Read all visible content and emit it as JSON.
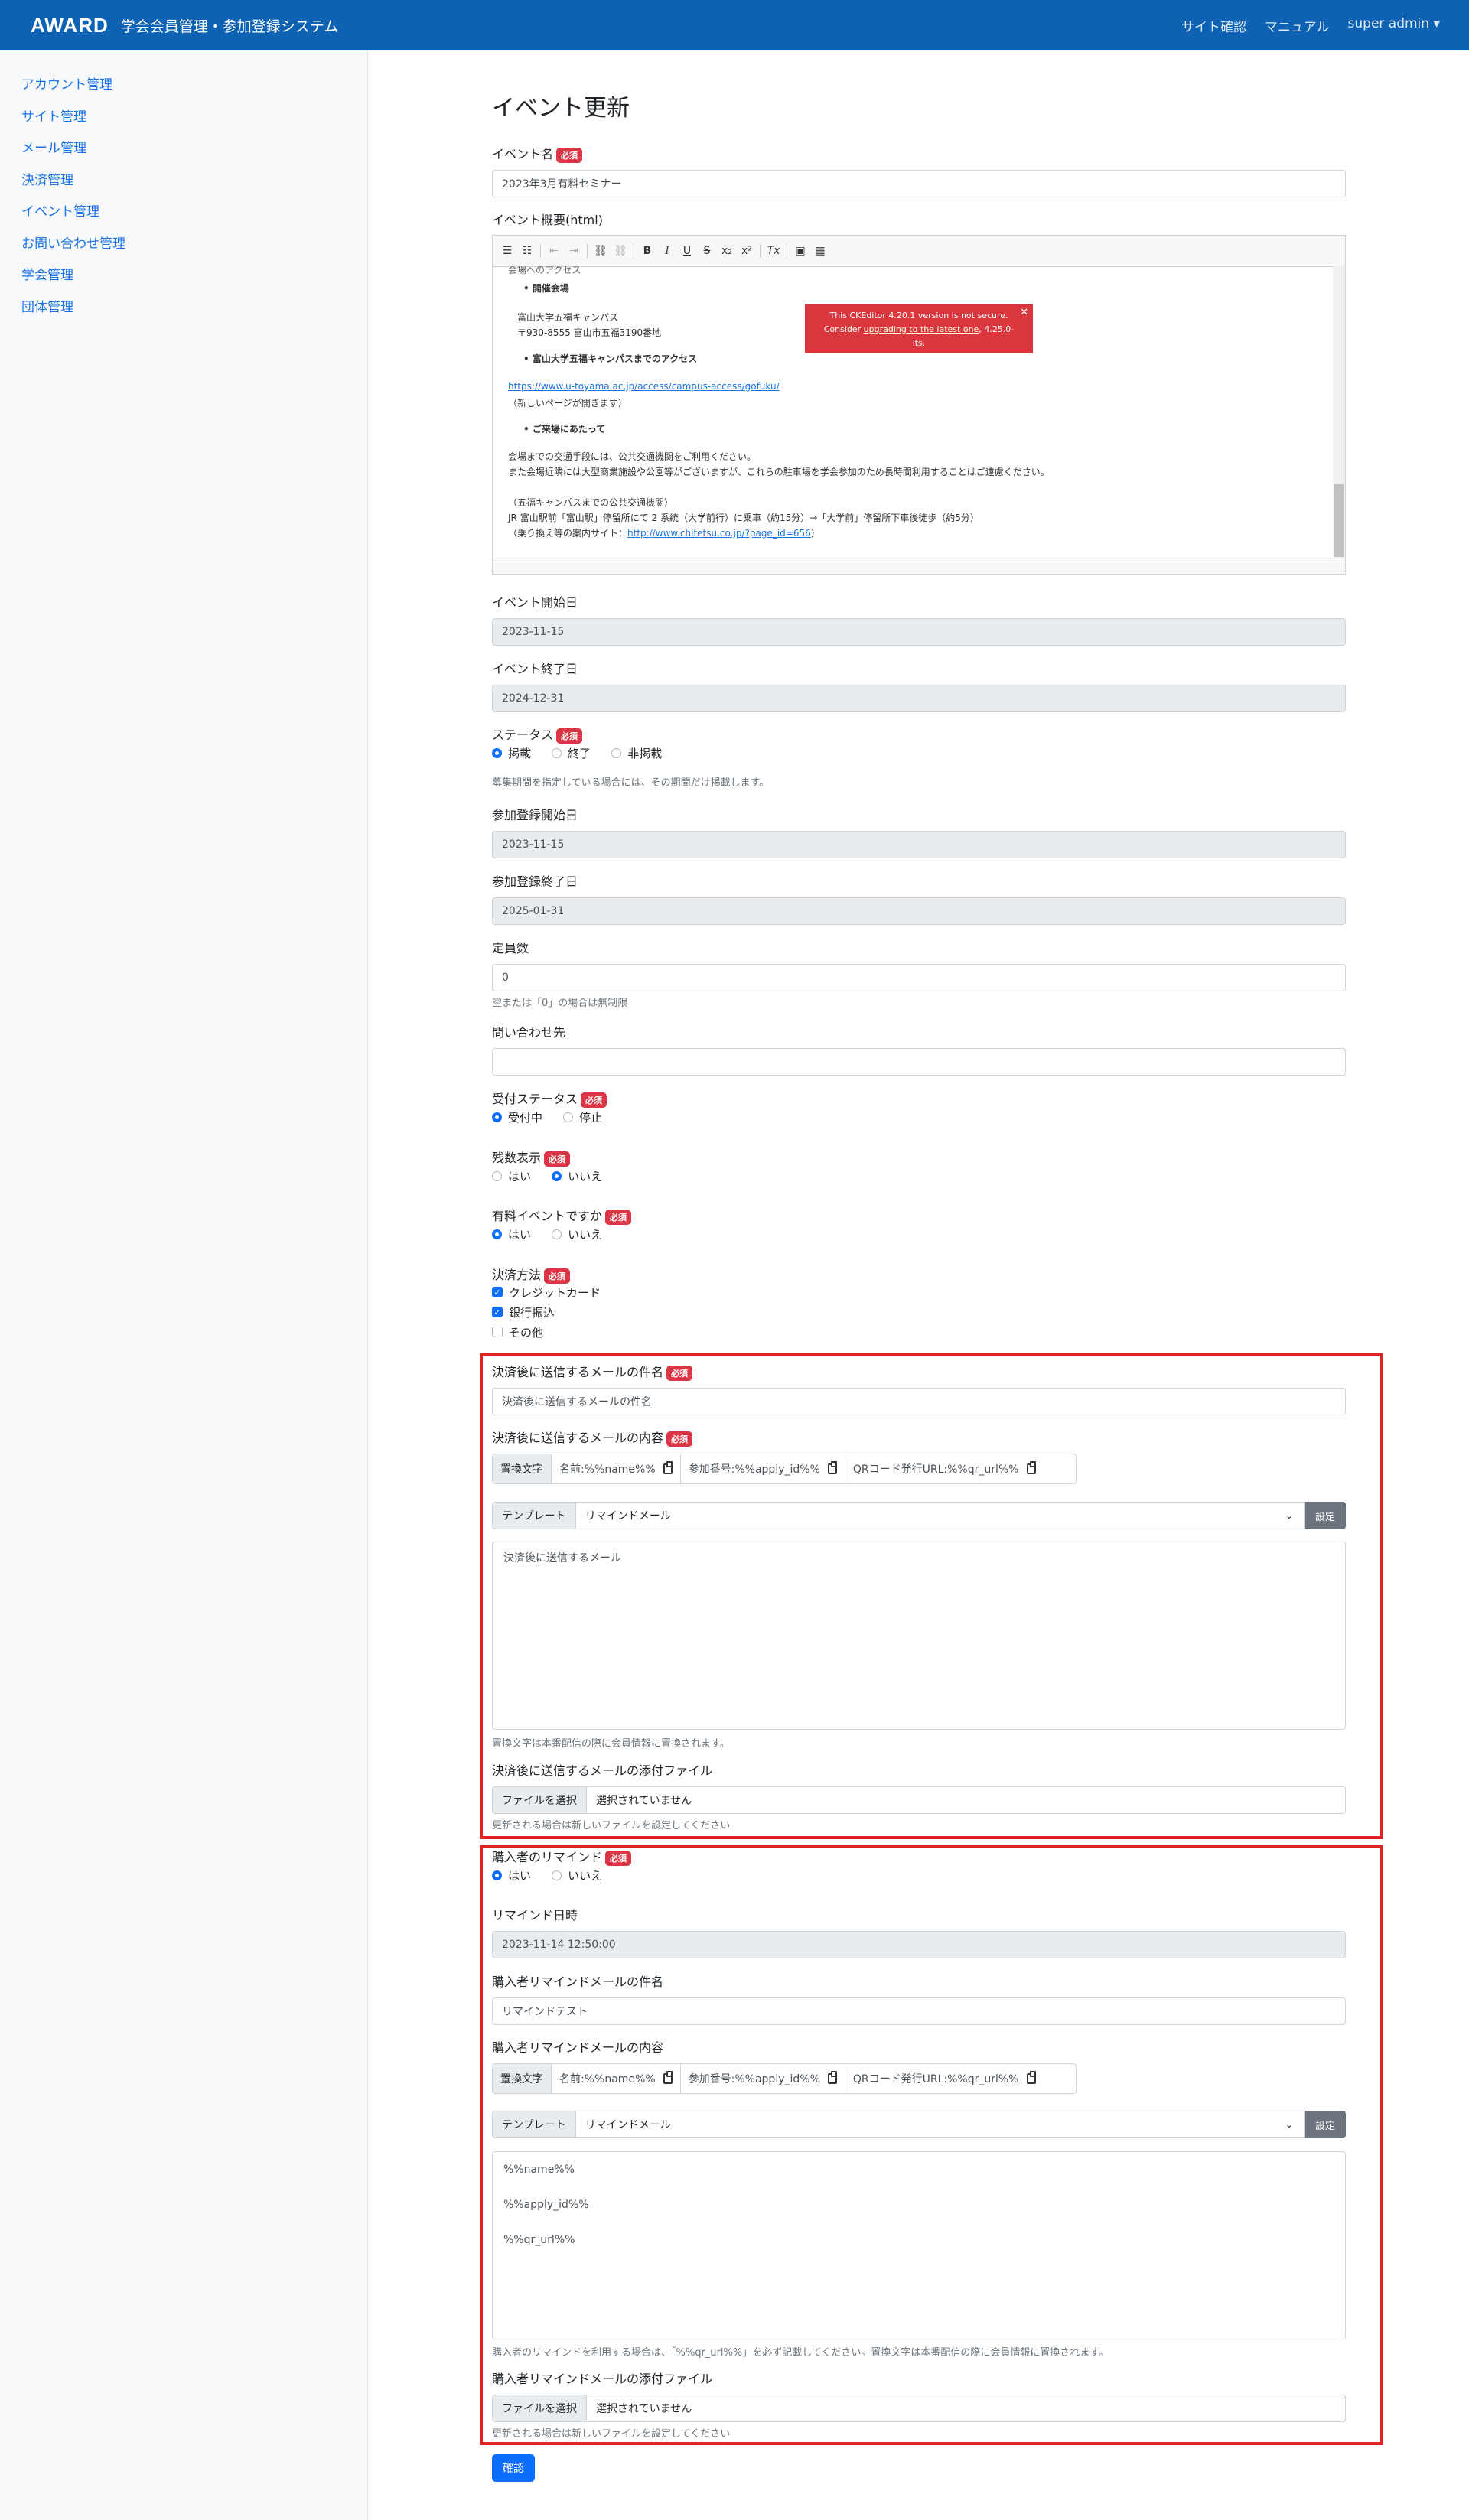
{
  "header": {
    "logo": "AWARD",
    "title": "学会会員管理・参加登録システム",
    "links": [
      "サイト確認",
      "マニュアル",
      "super admin ▾"
    ]
  },
  "sidebar": {
    "items": [
      "アカウント管理",
      "サイト管理",
      "メール管理",
      "決済管理",
      "イベント管理",
      "お問い合わせ管理",
      "学会管理",
      "団体管理"
    ]
  },
  "page": {
    "title": "イベント更新",
    "required": "必須",
    "event_name": {
      "label": "イベント名",
      "value": "2023年3月有料セミナー"
    },
    "overview": {
      "label": "イベント概要(html)"
    },
    "editor": {
      "lines": [
        "会場へのアクセス",
        "開催会場",
        "富山大学五福キャンパス",
        "〒930-8555 富山市五福3190番地",
        "富山大学五福キャンパスまでのアクセス",
        "https://www.u-toyama.ac.jp/access/campus-access/gofuku/",
        "（新しいページが開きます）",
        "ご来場にあたって",
        "会場までの交通手段には、公共交通機関をご利用ください。",
        "また会場近隣には大型商業施設や公園等がございますが、これらの駐車場を学会参加のため長時間利用することはご遠慮ください。",
        "（五福キャンパスまでの公共交通機関）",
        "JR 富山駅前「富山駅」停留所にて 2 系統（大学前行）に乗車（約15分）→「大学前」停留所下車後徒歩（約5分）",
        "（乗り換え等の案内サイト：",
        "http://www.chitetsu.co.jp/?page_id=656",
        "）"
      ],
      "warning": {
        "line1": "This CKEditor 4.20.1 version is not secure.",
        "line2a": "Consider ",
        "link": "upgrading to the latest one",
        "line2b": ", 4.25.0-",
        "line3": "lts.",
        "close": "✕"
      }
    },
    "start_date": {
      "label": "イベント開始日",
      "value": "2023-11-15"
    },
    "end_date": {
      "label": "イベント終了日",
      "value": "2024-12-31"
    },
    "status": {
      "label": "ステータス",
      "options": [
        "掲載",
        "終了",
        "非掲載"
      ],
      "hint": "募集期間を指定している場合には、その期間だけ掲載します。"
    },
    "reg_start": {
      "label": "参加登録開始日",
      "value": "2023-11-15"
    },
    "reg_end": {
      "label": "参加登録終了日",
      "value": "2025-01-31"
    },
    "capacity": {
      "label": "定員数",
      "value": "0",
      "hint": "空または「0」の場合は無制限"
    },
    "contact": {
      "label": "問い合わせ先",
      "value": ""
    },
    "accept_status": {
      "label": "受付ステータス",
      "options": [
        "受付中",
        "停止"
      ]
    },
    "remaining": {
      "label": "残数表示",
      "options": [
        "はい",
        "いいえ"
      ]
    },
    "paid": {
      "label": "有料イベントですか",
      "options": [
        "はい",
        "いいえ"
      ]
    },
    "payment": {
      "label": "決済方法",
      "options": [
        "クレジットカード",
        "銀行振込",
        "その他"
      ]
    },
    "post_mail": {
      "subject_label": "決済後に送信するメールの件名",
      "subject_value": "決済後に送信するメールの件名",
      "body_label": "決済後に送信するメールの内容",
      "replace_label": "置換文字",
      "vars": [
        "名前:%%name%%",
        "参加番号:%%apply_id%%",
        "QRコード発行URL:%%qr_url%%"
      ],
      "template_label": "テンプレート",
      "template_value": "リマインドメール",
      "set_button": "設定",
      "body_value": "決済後に送信するメール",
      "body_hint": "置換文字は本番配信の際に会員情報に置換されます。",
      "attach_label": "決済後に送信するメールの添付ファイル",
      "file_button": "ファイルを選択",
      "file_none": "選択されていません",
      "attach_hint": "更新される場合は新しいファイルを設定してください"
    },
    "remind": {
      "label": "購入者のリマインド",
      "options": [
        "はい",
        "いいえ"
      ],
      "datetime_label": "リマインド日時",
      "datetime_value": "2023-11-14 12:50:00",
      "subject_label": "購入者リマインドメールの件名",
      "subject_value": "リマインドテスト",
      "body_label": "購入者リマインドメールの内容",
      "replace_label": "置換文字",
      "vars": [
        "名前:%%name%%",
        "参加番号:%%apply_id%%",
        "QRコード発行URL:%%qr_url%%"
      ],
      "template_label": "テンプレート",
      "template_value": "リマインドメール",
      "set_button": "設定",
      "body_lines": [
        "%%name%%",
        "%%apply_id%%",
        "%%qr_url%%"
      ],
      "body_hint": "購入者のリマインドを利用する場合は、「%%qr_url%%」を必ず記載してください。置換文字は本番配信の際に会員情報に置換されます。",
      "attach_label": "購入者リマインドメールの添付ファイル",
      "file_button": "ファイルを選択",
      "file_none": "選択されていません",
      "attach_hint": "更新される場合は新しいファイルを設定してください"
    },
    "submit": "確認"
  }
}
